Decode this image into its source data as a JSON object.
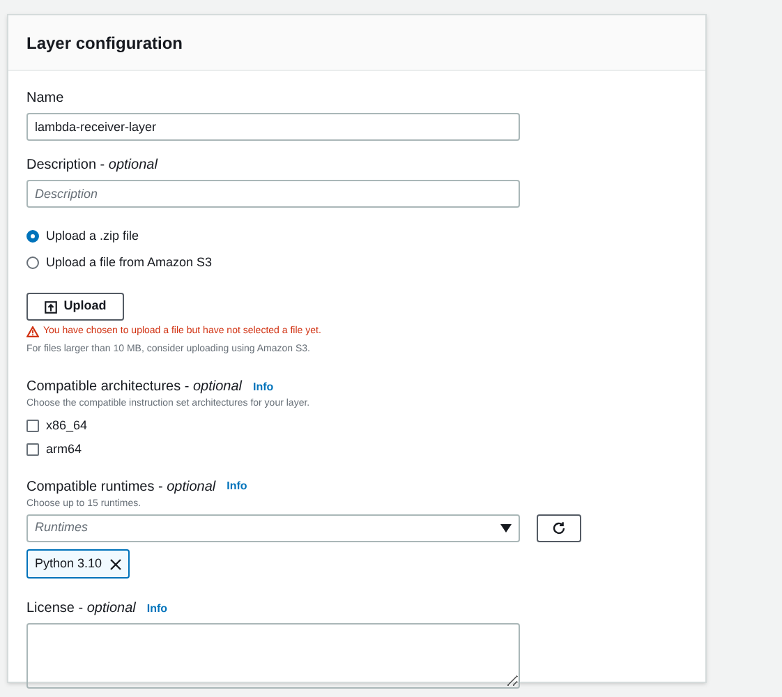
{
  "panel": {
    "title": "Layer configuration"
  },
  "name_field": {
    "label": "Name",
    "value": "lambda-receiver-layer"
  },
  "description_field": {
    "label": "Description - *optional*",
    "placeholder": "Description"
  },
  "upload_source": [
    {
      "label": "Upload a .zip file",
      "selected": true
    },
    {
      "label": "Upload a file from Amazon S3",
      "selected": false
    }
  ],
  "upload_button": {
    "label": "Upload"
  },
  "error": "You have chosen to upload a file but have not selected a file yet.",
  "upload_hint": "For files larger than 10 MB, consider uploading using Amazon S3.",
  "architectures": {
    "label": "Compatible architectures - *optional*",
    "info": "Info",
    "hint": "Choose the compatible instruction set architectures for your layer.",
    "options": [
      {
        "label": "x86_64",
        "checked": false
      },
      {
        "label": "arm64",
        "checked": false
      }
    ]
  },
  "runtimes": {
    "label": "Compatible runtimes - *optional*",
    "info": "Info",
    "hint": "Choose up to 15 runtimes.",
    "placeholder": "Runtimes",
    "tokens": [
      "Python 3.10"
    ]
  },
  "license": {
    "label": "License - *optional*",
    "info": "Info"
  }
}
